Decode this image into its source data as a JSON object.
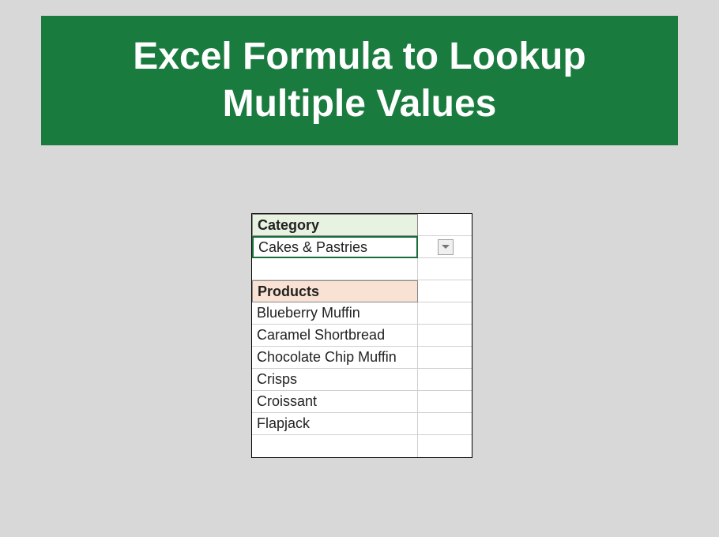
{
  "title": "Excel Formula to Lookup Multiple Values",
  "category": {
    "header": "Category",
    "selected": "Cakes & Pastries"
  },
  "products": {
    "header": "Products",
    "items": [
      "Blueberry Muffin",
      "Caramel Shortbread",
      "Chocolate Chip Muffin",
      "Crisps",
      "Croissant",
      "Flapjack"
    ]
  }
}
